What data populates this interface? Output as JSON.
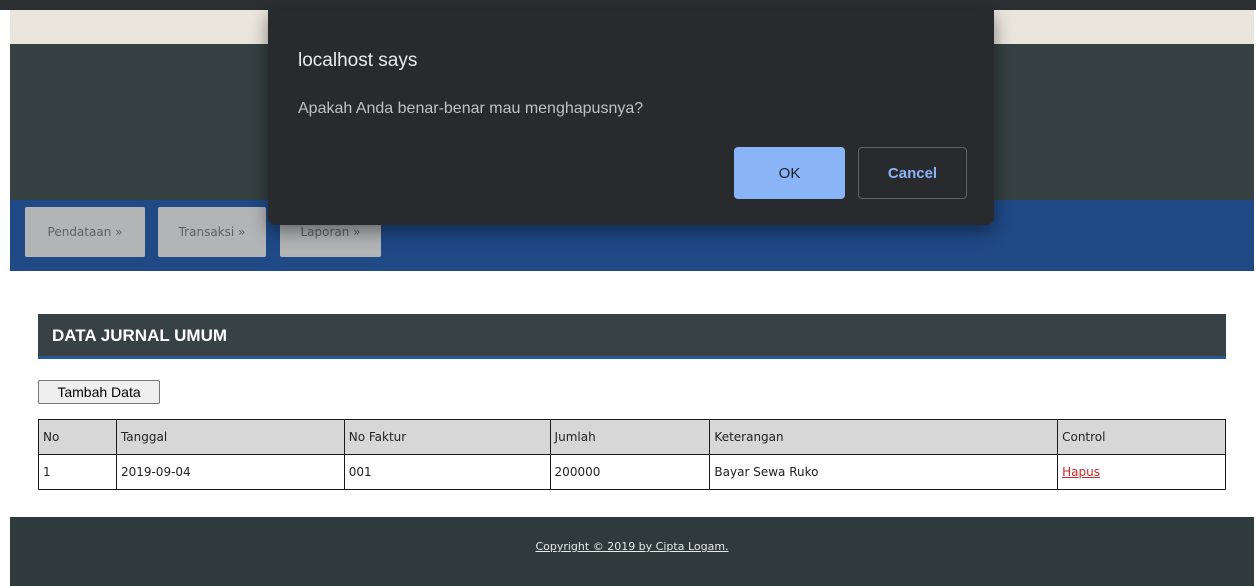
{
  "nav": {
    "items": [
      {
        "label": "Pendataan »"
      },
      {
        "label": "Transaksi »"
      },
      {
        "label": "Laporan »"
      }
    ]
  },
  "section": {
    "title": "DATA JURNAL UMUM"
  },
  "toolbar": {
    "add_label": "Tambah Data"
  },
  "table": {
    "headers": [
      "No",
      "Tanggal",
      "No Faktur",
      "Jumlah",
      "Keterangan",
      "Control"
    ],
    "rows": [
      {
        "no": "1",
        "tanggal": "2019-09-04",
        "faktur": "001",
        "jumlah": "200000",
        "keterangan": "Bayar Sewa Ruko",
        "control": "Hapus"
      }
    ]
  },
  "footer": {
    "text": "Copyright © 2019 by Cipta Logam."
  },
  "dialog": {
    "title": "localhost says",
    "message": "Apakah Anda benar-benar mau menghapusnya?",
    "ok_label": "OK",
    "cancel_label": "Cancel"
  },
  "colors": {
    "header_band": "#354142",
    "nav_bar": "#1f4a86",
    "dialog_bg": "#292a2d",
    "ok_button": "#8ab4f8",
    "link_red": "#d12424"
  }
}
